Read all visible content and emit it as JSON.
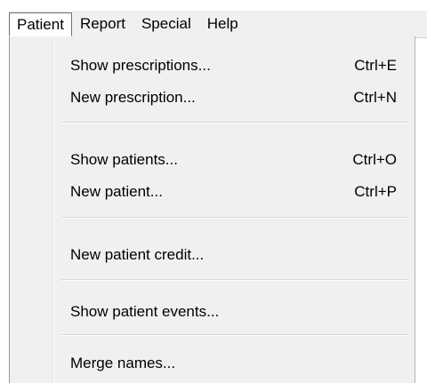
{
  "menubar": {
    "items": [
      {
        "label": "Patient"
      },
      {
        "label": "Report"
      },
      {
        "label": "Special"
      },
      {
        "label": "Help"
      }
    ]
  },
  "menu": {
    "items": [
      {
        "label": "Show prescriptions...",
        "shortcut": "Ctrl+E"
      },
      {
        "label": "New prescription...",
        "shortcut": "Ctrl+N"
      },
      {
        "label": "Show patients...",
        "shortcut": "Ctrl+O"
      },
      {
        "label": "New patient...",
        "shortcut": "Ctrl+P"
      },
      {
        "label": "New patient credit...",
        "shortcut": ""
      },
      {
        "label": "Show patient events...",
        "shortcut": ""
      },
      {
        "label": "Merge names...",
        "shortcut": ""
      }
    ]
  },
  "colors": {
    "menu_background": "#f0f0f0",
    "text": "#000000",
    "separator": "#d7d7d7"
  }
}
